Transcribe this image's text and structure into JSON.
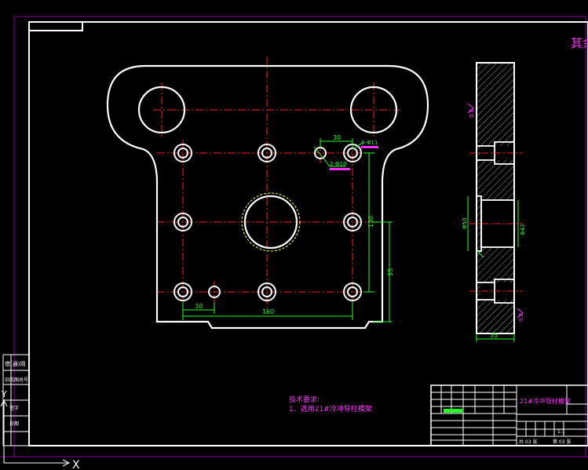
{
  "title_partial": "其余",
  "surface_finish": [
    "0.8",
    "0.8"
  ],
  "dimensions": {
    "d30_top": "30",
    "d_hole1": "8-Φ11",
    "d_hole2": "2-Φ10",
    "d130": "130",
    "d35v": "35",
    "d30_bot": "30",
    "d160": "160",
    "d50": "Φ50",
    "d42": "Φ42",
    "thickness": "35"
  },
  "tech_req": {
    "heading": "技术要求:",
    "line1": "1、选用21#冷冲导柱模架"
  },
  "title_block": {
    "drawing_name": "21#冷冲导柱模架",
    "scale": "1:1",
    "sheet_total": "共 03 张",
    "sheet_no": "第 03 张"
  },
  "left_strip": [
    "借(通)用",
    "旧底图总号",
    "签字",
    "日期"
  ],
  "colors": {
    "outline": "#ffffff",
    "centerline": "#ff2020",
    "dimension": "#20ff20",
    "text_magenta": "#ff30ff",
    "frame": "#8a00a0",
    "hatch": "#ffffff",
    "hidden": "#ffff40"
  }
}
